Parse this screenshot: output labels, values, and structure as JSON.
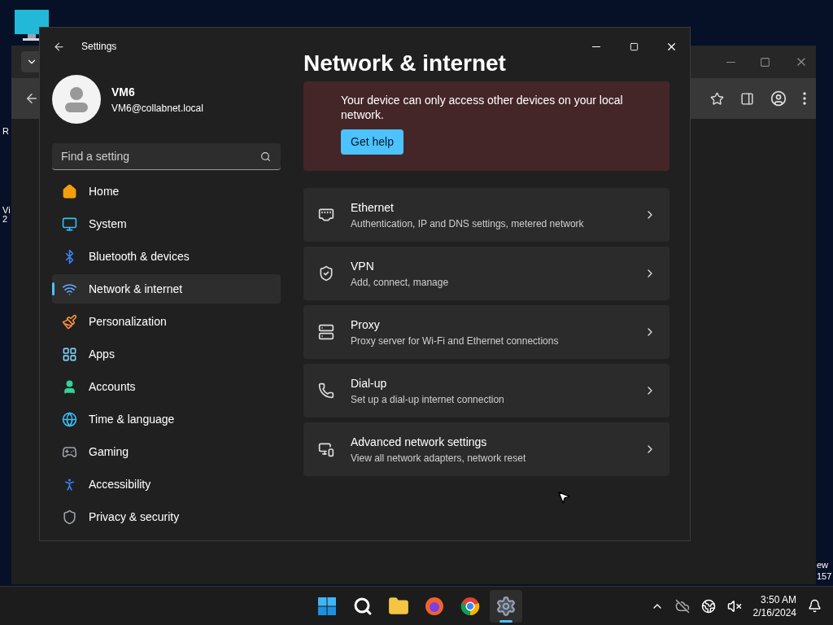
{
  "desktop": {
    "left_fragments": [
      "R",
      "Vi",
      "2"
    ],
    "right_fragments": [
      "ew",
      "157"
    ]
  },
  "window": {
    "title": "Settings"
  },
  "user": {
    "name": "VM6",
    "email": "VM6@collabnet.local"
  },
  "search": {
    "placeholder": "Find a setting"
  },
  "nav": [
    {
      "kind": "home",
      "label": "Home",
      "selected": false
    },
    {
      "kind": "system",
      "label": "System",
      "selected": false
    },
    {
      "kind": "bluetooth",
      "label": "Bluetooth & devices",
      "selected": false
    },
    {
      "kind": "network",
      "label": "Network & internet",
      "selected": true
    },
    {
      "kind": "personalization",
      "label": "Personalization",
      "selected": false
    },
    {
      "kind": "apps",
      "label": "Apps",
      "selected": false
    },
    {
      "kind": "accounts",
      "label": "Accounts",
      "selected": false
    },
    {
      "kind": "time",
      "label": "Time & language",
      "selected": false
    },
    {
      "kind": "gaming",
      "label": "Gaming",
      "selected": false
    },
    {
      "kind": "accessibility",
      "label": "Accessibility",
      "selected": false
    },
    {
      "kind": "privacy",
      "label": "Privacy & security",
      "selected": false
    }
  ],
  "page_title": "Network & internet",
  "alert": {
    "message": "Your device can only access other devices on your local network.",
    "button": "Get help"
  },
  "items": [
    {
      "kind": "ethernet",
      "title": "Ethernet",
      "subtitle": "Authentication, IP and DNS settings, metered network"
    },
    {
      "kind": "vpn",
      "title": "VPN",
      "subtitle": "Add, connect, manage"
    },
    {
      "kind": "proxy",
      "title": "Proxy",
      "subtitle": "Proxy server for Wi-Fi and Ethernet connections"
    },
    {
      "kind": "dialup",
      "title": "Dial-up",
      "subtitle": "Set up a dial-up internet connection"
    },
    {
      "kind": "advanced",
      "title": "Advanced network settings",
      "subtitle": "View all network adapters, network reset"
    }
  ],
  "taskbar": {
    "apps": [
      {
        "kind": "start",
        "selected": false
      },
      {
        "kind": "search",
        "selected": false
      },
      {
        "kind": "files",
        "selected": false
      },
      {
        "kind": "firefox",
        "selected": false
      },
      {
        "kind": "chrome",
        "selected": false
      },
      {
        "kind": "settings",
        "selected": true
      }
    ],
    "time": "3:50 AM",
    "date": "2/16/2024"
  }
}
